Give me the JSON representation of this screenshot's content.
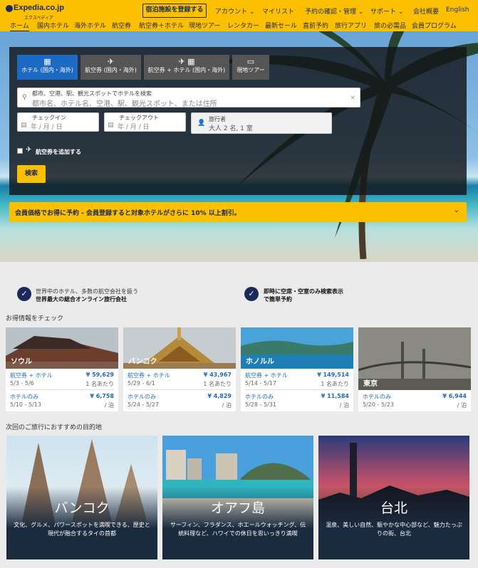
{
  "header": {
    "logo_text": "Expedia.co.jp",
    "logo_sub": "エクスペディア",
    "register_button": "宿泊施設を登録する",
    "nav": [
      "アカウント",
      "マイリスト",
      "予約の確認・管理",
      "サポート",
      "会社概要",
      "English"
    ],
    "secondary_nav": [
      "ホーム",
      "国内ホテル",
      "海外ホテル",
      "航空券",
      "航空券＋ホテル",
      "現地ツアー",
      "レンタカー",
      "最新セール",
      "直前予約",
      "旅行アプリ",
      "旅の必需品",
      "会員プログラム"
    ]
  },
  "search": {
    "tabs": [
      {
        "label": "ホテル (国内・海外)",
        "icon": "hotel-icon"
      },
      {
        "label": "航空券 (国内・海外)",
        "icon": "plane-icon"
      },
      {
        "label": "航空券 + ホテル (国内・海外)",
        "icon": "plane-hotel-icon"
      },
      {
        "label": "現地ツアー",
        "icon": "ticket-icon"
      }
    ],
    "destination_label": "都市、空港、駅、観光スポットでホテルを検索",
    "destination_placeholder": "都市名、ホテル名、空港、駅、観光スポット、または住所",
    "checkin_label": "チェックイン",
    "checkin_value": "年 / 月 / 日",
    "checkout_label": "チェックアウト",
    "checkout_value": "年 / 月 / 日",
    "travelers_label": "旅行者",
    "travelers_value": "大人 2 名, 1 室",
    "add_flight_label": "航空券を追加する",
    "search_button": "検索"
  },
  "banner_text": "会員価格でお得に予約 - 会員登録すると対象ホテルがさらに 10% 以上割引。",
  "features": [
    {
      "line1": "世界中のホテル、多数の航空会社を扱う",
      "line2": "世界最大の総合オンライン旅行会社"
    },
    {
      "line1": "即時に空席・空室のみ検索表示",
      "line2": "で簡単予約"
    }
  ],
  "deals_title": "お得情報をチェック",
  "deals": [
    {
      "city": "ソウル",
      "pkg_label": "航空券 + ホテル",
      "pkg_price": "¥ 59,629",
      "pkg_dates": "5/3 - 5/6",
      "pkg_note": "1 名あたり",
      "hotel_label": "ホテルのみ",
      "hotel_price": "¥ 6,758",
      "hotel_dates": "5/10 - 5/13",
      "hotel_note": "/ 泊"
    },
    {
      "city": "バンコク",
      "pkg_label": "航空券 + ホテル",
      "pkg_price": "¥ 43,967",
      "pkg_dates": "5/29 - 6/1",
      "pkg_note": "1 名あたり",
      "hotel_label": "ホテルのみ",
      "hotel_price": "¥ 4,829",
      "hotel_dates": "5/24 - 5/27",
      "hotel_note": "/ 泊"
    },
    {
      "city": "ホノルル",
      "pkg_label": "航空券 + ホテル",
      "pkg_price": "¥ 149,514",
      "pkg_dates": "5/14 - 5/17",
      "pkg_note": "1 名あたり",
      "hotel_label": "ホテルのみ",
      "hotel_price": "¥ 11,584",
      "hotel_dates": "5/28 - 5/31",
      "hotel_note": "/ 泊"
    },
    {
      "city": "東京",
      "hotel_label": "ホテルのみ",
      "hotel_price": "¥ 6,944",
      "hotel_dates": "5/20 - 5/23",
      "hotel_note": "/ 泊"
    }
  ],
  "dest_title": "次回のご旅行におすすめの目的地",
  "destinations": [
    {
      "name": "バンコク",
      "desc": "文化、グルメ、パワースポットを満喫できる、歴史と現代が融合するタイの首都"
    },
    {
      "name": "オアフ島",
      "desc": "サーフィン、フラダンス、ホエールウォッチング、伝統料理など、ハワイでの休日を思いっきり満喫"
    },
    {
      "name": "台北",
      "desc": "温泉、美しい自然、賑やかな中心部など、魅力たっぷりの街、台北"
    }
  ],
  "colors": {
    "brand_yellow": "#fcc000",
    "brand_navy": "#1a2b5b",
    "tab_active": "#1d6ac4",
    "price_blue": "#1d6ac4"
  }
}
